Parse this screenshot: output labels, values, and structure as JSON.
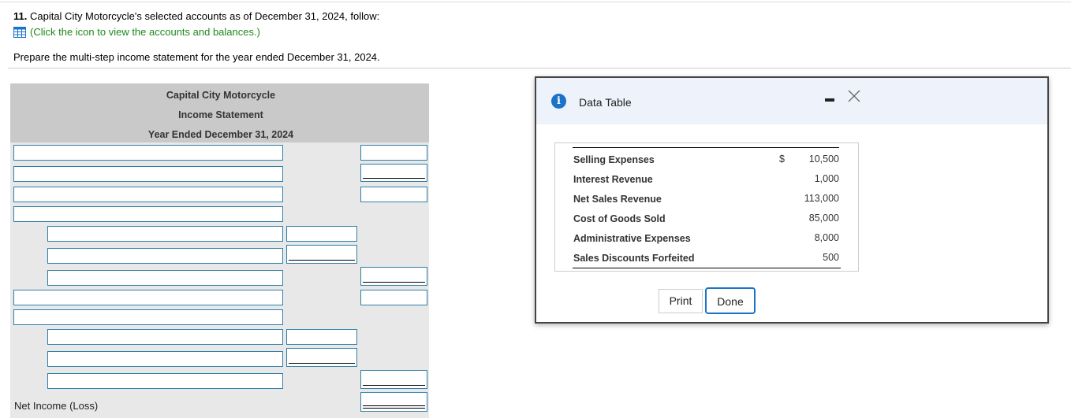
{
  "question": {
    "number": "11.",
    "text": " Capital City Motorcycle's selected accounts as of December 31, 2024, follow:",
    "link_text": "(Click the icon to view the accounts and balances.)",
    "instruction": "Prepare the multi-step income statement for the year ended December 31, 2024."
  },
  "statement": {
    "company": "Capital City Motorcycle",
    "title": "Income Statement",
    "period": "Year Ended December 31, 2024",
    "net_income_label": "Net Income (Loss)"
  },
  "modal": {
    "title": "Data Table",
    "rows": [
      {
        "label": "Selling Expenses",
        "currency": "$",
        "value": "10,500"
      },
      {
        "label": "Interest Revenue",
        "currency": "",
        "value": "1,000"
      },
      {
        "label": "Net Sales Revenue",
        "currency": "",
        "value": "113,000"
      },
      {
        "label": "Cost of Goods Sold",
        "currency": "",
        "value": "85,000"
      },
      {
        "label": "Administrative Expenses",
        "currency": "",
        "value": "8,000"
      },
      {
        "label": "Sales Discounts Forfeited",
        "currency": "",
        "value": "500"
      }
    ],
    "print_label": "Print",
    "done_label": "Done"
  },
  "colors": {
    "link": "#1a8a1a",
    "input_border": "#2f7fa8",
    "accent": "#1a73c8"
  },
  "icons": [
    "table-icon",
    "info-icon",
    "minimize-icon",
    "close-icon"
  ]
}
